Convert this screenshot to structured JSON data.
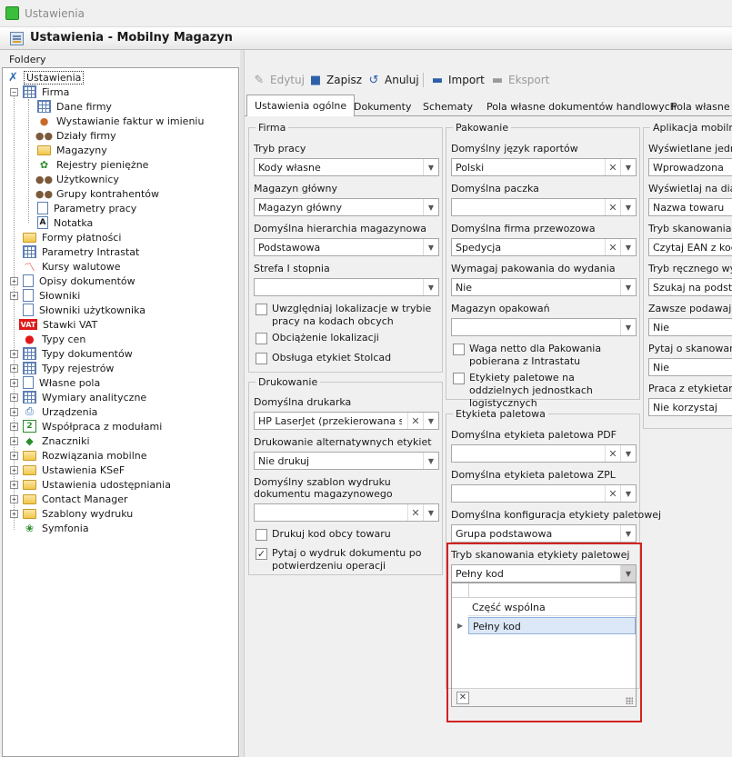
{
  "window": {
    "title": "Ustawienia",
    "doc_title": "Ustawienia - Mobilny Magazyn"
  },
  "folders": {
    "label": "Foldery",
    "items": [
      {
        "label": "Ustawienia",
        "icon": "wrench-icon"
      },
      {
        "label": "Firma",
        "icon": "grid-icon"
      },
      {
        "label": "Dane firmy",
        "icon": "grid-icon"
      },
      {
        "label": "Wystawianie faktur w imieniu",
        "icon": "person-icon"
      },
      {
        "label": "Działy firmy",
        "icon": "people-icon"
      },
      {
        "label": "Magazyny",
        "icon": "folder-icon"
      },
      {
        "label": "Rejestry pieniężne",
        "icon": "money-icon"
      },
      {
        "label": "Użytkownicy",
        "icon": "people-icon"
      },
      {
        "label": "Grupy kontrahentów",
        "icon": "people-icon"
      },
      {
        "label": "Parametry pracy",
        "icon": "doc-icon"
      },
      {
        "label": "Notatka",
        "icon": "note-icon"
      },
      {
        "label": "Formy płatności",
        "icon": "folder-icon"
      },
      {
        "label": "Parametry Intrastat",
        "icon": "grid-icon"
      },
      {
        "label": "Kursy walutowe",
        "icon": "chart-icon"
      },
      {
        "label": "Opisy dokumentów",
        "icon": "doc-icon"
      },
      {
        "label": "Słowniki",
        "icon": "doc-icon"
      },
      {
        "label": "Słowniki użytkownika",
        "icon": "doc-icon"
      },
      {
        "label": "Stawki VAT",
        "icon": "vat-icon"
      },
      {
        "label": "Typy cen",
        "icon": "red-dot-icon"
      },
      {
        "label": "Typy dokumentów",
        "icon": "grid-icon"
      },
      {
        "label": "Typy rejestrów",
        "icon": "grid-icon"
      },
      {
        "label": "Własne pola",
        "icon": "doc-icon"
      },
      {
        "label": "Wymiary analityczne",
        "icon": "grid-icon"
      },
      {
        "label": "Urządzenia",
        "icon": "printer-icon"
      },
      {
        "label": "Współpraca z modułami",
        "icon": "module-icon"
      },
      {
        "label": "Znaczniki",
        "icon": "tag-icon"
      },
      {
        "label": "Rozwiązania mobilne",
        "icon": "folder-icon"
      },
      {
        "label": "Ustawienia KSeF",
        "icon": "folder-icon"
      },
      {
        "label": "Ustawienia udostępniania",
        "icon": "folder-icon"
      },
      {
        "label": "Contact Manager",
        "icon": "folder-icon"
      },
      {
        "label": "Szablony wydruku",
        "icon": "folder-icon"
      },
      {
        "label": "Symfonia",
        "icon": "symfonia-icon"
      }
    ]
  },
  "toolbar": {
    "edit": "Edytuj",
    "save": "Zapisz",
    "cancel": "Anuluj",
    "import": "Import",
    "export": "Eksport"
  },
  "tabs": [
    "Ustawienia ogólne",
    "Dokumenty",
    "Schematy",
    "Pola własne dokumentów handlowych",
    "Pola własne d"
  ],
  "firma": {
    "title": "Firma",
    "tryb_pracy": {
      "label": "Tryb pracy",
      "value": "Kody własne"
    },
    "magazyn_glowny": {
      "label": "Magazyn główny",
      "value": "Magazyn główny"
    },
    "hierarchia": {
      "label": "Domyślna hierarchia magazynowa",
      "value": "Podstawowa"
    },
    "strefa": {
      "label": "Strefa I stopnia",
      "value": ""
    },
    "chk_lokalizacje": "Uwzględniaj lokalizacje w trybie pracy na kodach obcych",
    "chk_obciazenie": "Obciążenie lokalizacji",
    "chk_stolcad": "Obsługa etykiet Stolcad"
  },
  "drukowanie": {
    "title": "Drukowanie",
    "drukarka": {
      "label": "Domyślna drukarka",
      "value": "HP LaserJet (przekierowana ses..."
    },
    "alternatywne": {
      "label": "Drukowanie alternatywnych etykiet",
      "value": "Nie drukuj"
    },
    "szablon": {
      "label": "Domyślny szablon wydruku dokumentu magazynowego",
      "value": ""
    },
    "chk_kod_obcy": "Drukuj kod obcy towaru",
    "chk_pytaj": "Pytaj o wydruk dokumentu po potwierdzeniu operacji"
  },
  "pakowanie": {
    "title": "Pakowanie",
    "jezyk": {
      "label": "Domyślny język raportów",
      "value": "Polski"
    },
    "paczka": {
      "label": "Domyślna paczka",
      "value": ""
    },
    "firma_przewozowa": {
      "label": "Domyślna firma przewozowa",
      "value": "Spedycja"
    },
    "wymagaj": {
      "label": "Wymagaj pakowania do wydania",
      "value": "Nie"
    },
    "magazyn_opakowan": {
      "label": "Magazyn opakowań",
      "value": ""
    },
    "chk_waga": "Waga netto dla Pakowania pobierana z Intrastatu",
    "chk_etykiety": "Etykiety paletowe na oddzielnych jednostkach logistycznych"
  },
  "etykieta": {
    "title": "Etykieta paletowa",
    "pdf": {
      "label": "Domyślna etykieta paletowa PDF",
      "value": ""
    },
    "zpl": {
      "label": "Domyślna etykieta paletowa ZPL",
      "value": ""
    },
    "konfiguracja": {
      "label": "Domyślna konfiguracja etykiety paletowej",
      "value": "Grupa podstawowa"
    },
    "tryb_skanowania": {
      "label": "Tryb skanowania etykiety paletowej",
      "value": "Pełny kod"
    },
    "options": [
      "Część wspólna",
      "Pełny kod"
    ]
  },
  "aplikacja": {
    "title": "Aplikacja mobilna",
    "fields": [
      {
        "label": "Wyświetlane jednos",
        "value": "Wprowadzona"
      },
      {
        "label": "Wyświetlaj na dialog",
        "value": "Nazwa towaru"
      },
      {
        "label": "Tryb skanowania ko",
        "value": "Czytaj EAN z kodu"
      },
      {
        "label": "Tryb ręcznego wysz",
        "value": "Szukaj na podstaw"
      },
      {
        "label": "Zawsze podawaj ilo",
        "value": "Nie"
      },
      {
        "label": "Pytaj o skanowanie",
        "value": "Nie"
      },
      {
        "label": "Praca z etykietami C",
        "value": "Nie korzystaj"
      }
    ]
  },
  "colors": {
    "highlight": "#d32121",
    "selected_row": "#dce8f7"
  }
}
